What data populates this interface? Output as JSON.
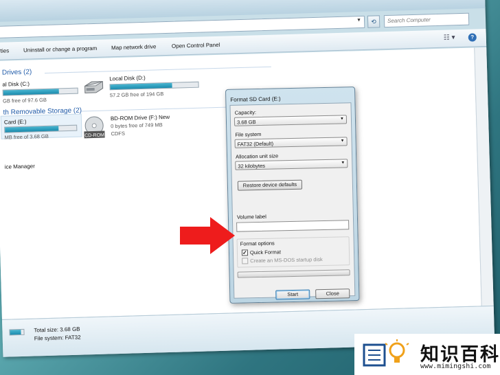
{
  "search": {
    "placeholder": "Search Computer"
  },
  "toolbar": {
    "items": [
      {
        "label": "rties"
      },
      {
        "label": "Uninstall or change a program"
      },
      {
        "label": "Map network drive"
      },
      {
        "label": "Open Control Panel"
      }
    ]
  },
  "groups": {
    "hard_drives": {
      "title": "Drives (2)"
    },
    "removable": {
      "title": "th Removable Storage (2)"
    }
  },
  "drives": {
    "c": {
      "name": "al Disk (C:)",
      "free": "GB free of 97.6 GB",
      "used_fraction": 0.75
    },
    "d": {
      "name": "Local Disk (D:)",
      "free": "57.2 GB free of 194 GB",
      "used_fraction": 0.7
    },
    "e": {
      "name": "Card (E:)",
      "free": "MB free of 3.68 GB",
      "used_fraction": 0.75
    },
    "f": {
      "name": "BD-ROM Drive (F:) New",
      "free": "0 bytes free of 749 MB",
      "fs": "CDFS",
      "icon_text": "CD-ROM"
    }
  },
  "other": {
    "device_manager": "ice Manager"
  },
  "details": {
    "total_size": "Total size: 3.68 GB",
    "file_system": "File system:  FAT32"
  },
  "dialog": {
    "title": "Format SD Card (E:)",
    "capacity_label": "Capacity:",
    "capacity_value": "3.68 GB",
    "filesystem_label": "File system",
    "filesystem_value": "FAT32 (Default)",
    "alloc_label": "Allocation unit size",
    "alloc_value": "32 kilobytes",
    "restore_button": "Restore device defaults",
    "volume_label": "Volume label",
    "volume_value": "",
    "format_options_label": "Format options",
    "quick_format_label": "Quick Format",
    "quick_format_checked": true,
    "msdos_label": "Create an MS-DOS startup disk",
    "msdos_checked": false,
    "start_button": "Start",
    "close_button": "Close"
  },
  "watermark": {
    "cn": "知识百科",
    "url": "www.mimingshi.com"
  },
  "colors": {
    "arrow": "#ee1c1c",
    "accent": "#1e5aa8",
    "drive_bar": "#1c8bad"
  }
}
